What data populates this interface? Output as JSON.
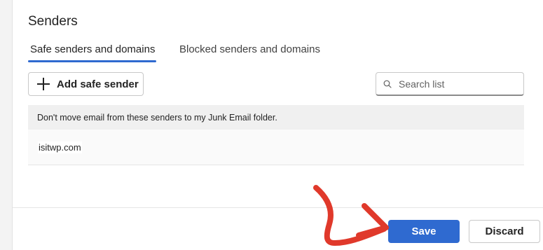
{
  "section": {
    "title": "Senders"
  },
  "tabs": [
    {
      "label": "Safe senders and domains",
      "active": true
    },
    {
      "label": "Blocked senders and domains",
      "active": false
    }
  ],
  "toolbar": {
    "add_label": "Add safe sender",
    "search_placeholder": "Search list",
    "search_value": ""
  },
  "list": {
    "description": "Don't move email from these senders to my Junk Email folder.",
    "entries": [
      "isitwp.com"
    ]
  },
  "footer": {
    "save_label": "Save",
    "discard_label": "Discard"
  },
  "colors": {
    "accent": "#2f6ad0",
    "annotation_arrow": "#e0392b"
  },
  "icons": {
    "add": "plus-icon",
    "search": "search-icon",
    "annotation": "arrow-icon"
  }
}
